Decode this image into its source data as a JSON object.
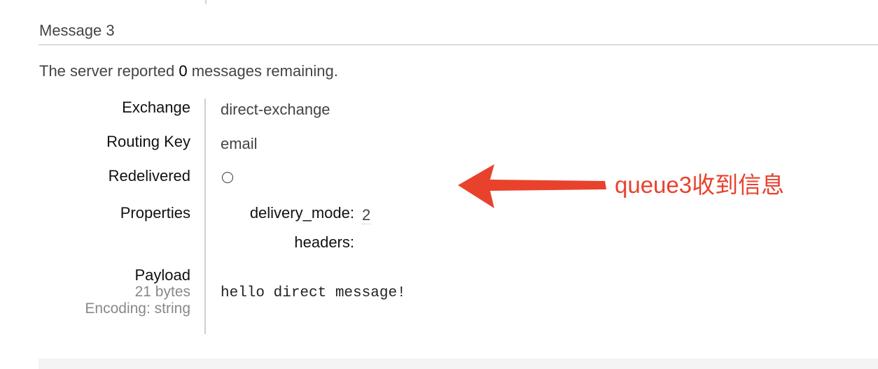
{
  "message": {
    "title": "Message 3",
    "summary_prefix": "The server reported",
    "summary_count": "0",
    "summary_suffix": "messages remaining."
  },
  "fields": {
    "exchange_label": "Exchange",
    "exchange_value": "direct-exchange",
    "routing_key_label": "Routing Key",
    "routing_key_value": "email",
    "redelivered_label": "Redelivered",
    "redelivered_value": "○",
    "properties_label": "Properties",
    "properties": [
      {
        "key": "delivery_mode:",
        "value": "2"
      },
      {
        "key": "headers:",
        "value": ""
      }
    ],
    "payload_label": "Payload",
    "payload_size": "21 bytes",
    "payload_encoding": "Encoding: string",
    "payload_value": "hello direct message!"
  },
  "annotation": {
    "text": "queue3收到信息",
    "color": "#e8422d"
  },
  "colors": {
    "text": "#444444",
    "muted": "#888888",
    "rule": "#dcdcdc"
  }
}
